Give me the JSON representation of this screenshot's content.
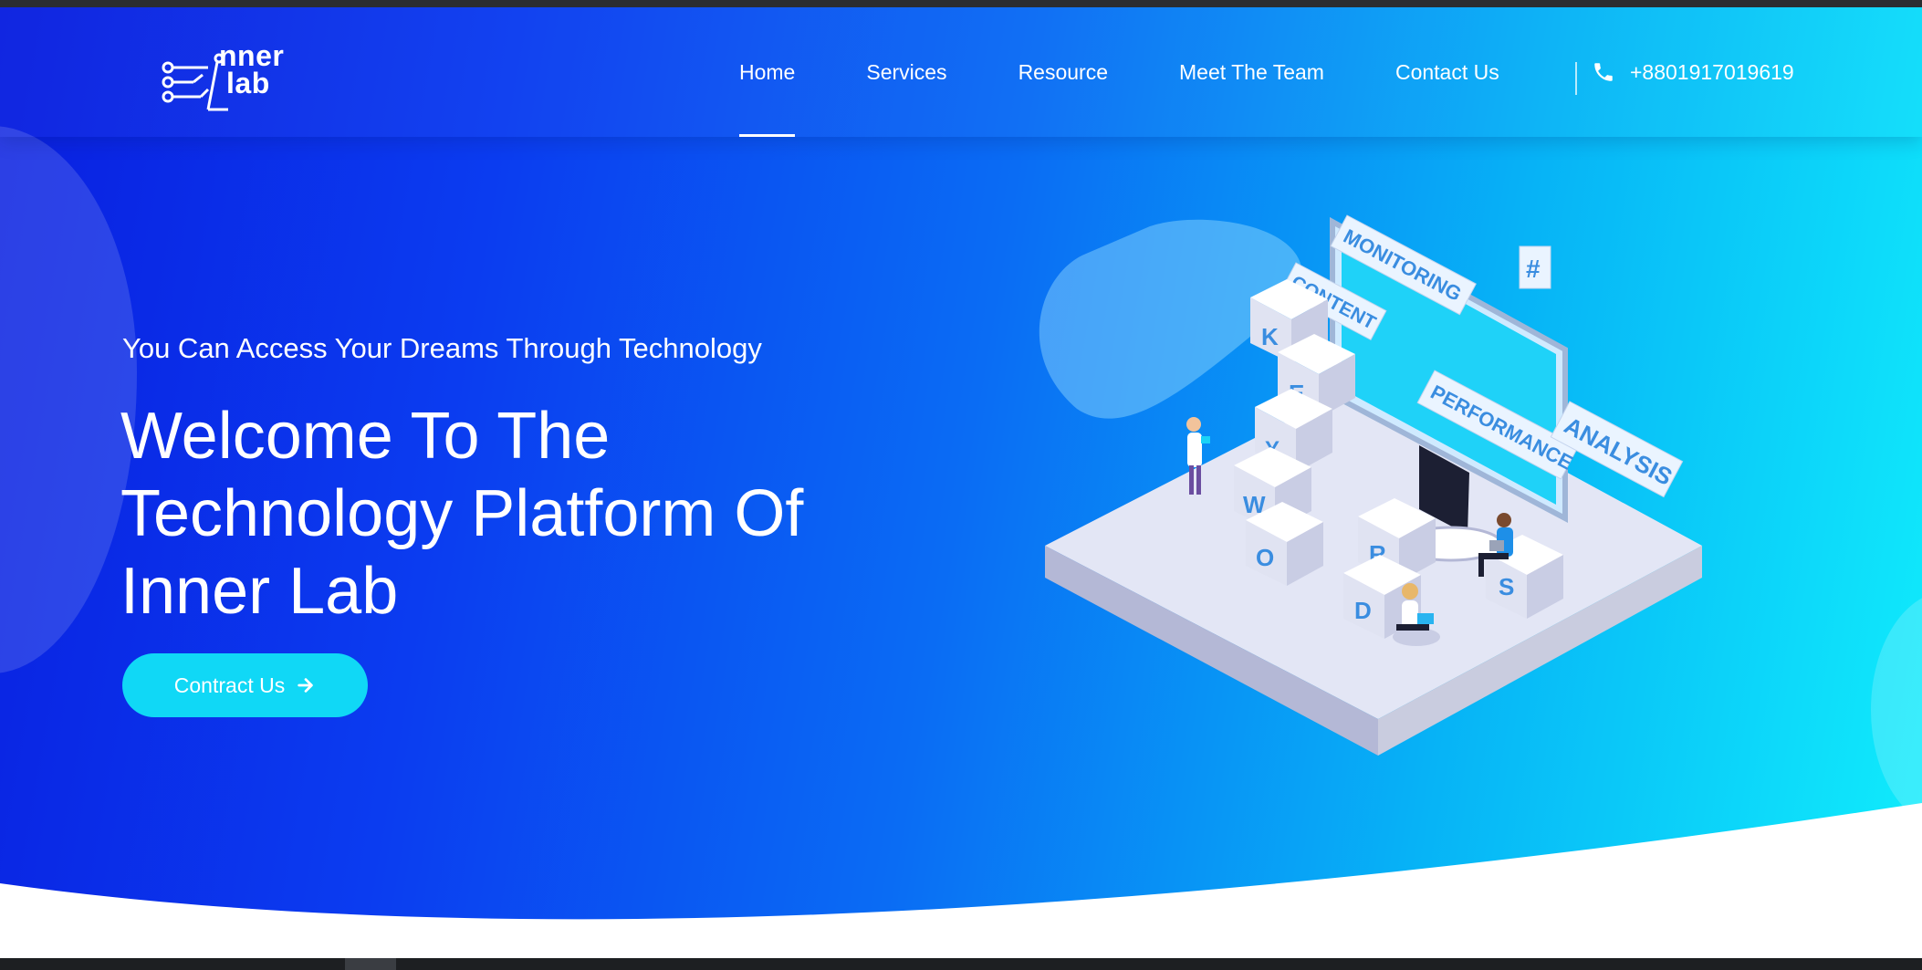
{
  "brand": {
    "logo_line1": "nner",
    "logo_line2": "lab"
  },
  "nav": {
    "items": [
      {
        "label": "Home",
        "active": true
      },
      {
        "label": "Services",
        "active": false
      },
      {
        "label": "Resource",
        "active": false
      },
      {
        "label": "Meet The Team",
        "active": false
      },
      {
        "label": "Contact Us",
        "active": false
      }
    ],
    "phone_icon": "phone-icon",
    "phone": "+8801917019619"
  },
  "hero": {
    "tagline": "You Can Access Your Dreams Through Technology",
    "headline": "Welcome To The Technology Platform Of Inner Lab",
    "cta_label": "Contract Us",
    "cta_icon": "arrow-right-icon"
  },
  "illustration": {
    "labels": {
      "monitoring": "MONITORING",
      "content": "CONTENT",
      "performance": "PERFORMANCE",
      "analysis": "ANALYSIS",
      "hash": "#"
    },
    "letters": [
      "K",
      "E",
      "Y",
      "W",
      "O",
      "R",
      "D",
      "S"
    ]
  },
  "colors": {
    "gradient_start": "#0a1fe0",
    "gradient_end": "#10eefc",
    "cta": "#10d8f6",
    "text": "#ffffff"
  }
}
